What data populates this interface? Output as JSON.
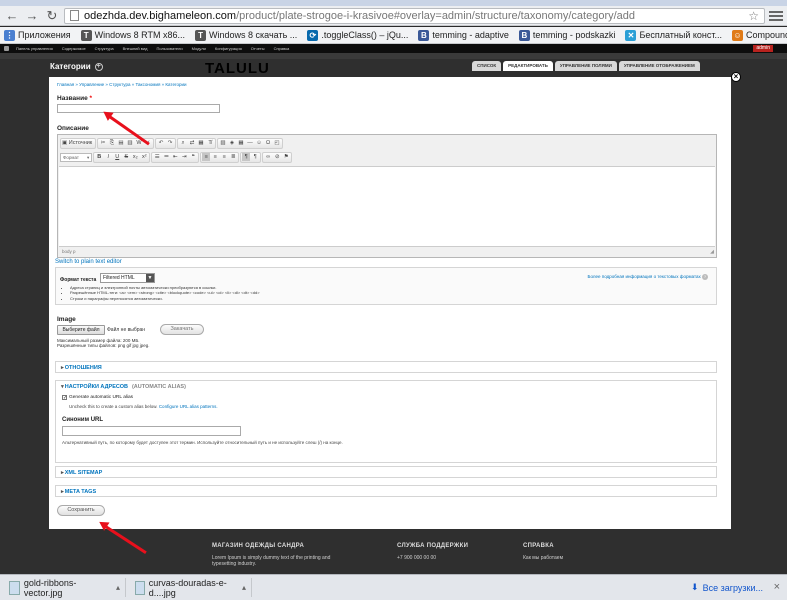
{
  "browser": {
    "url_host": "odezhda.dev.bighameleon.com",
    "url_path": "/product/plate-strogoe-i-krasivoe#overlay=admin/structure/taxonomy/category/add",
    "bookmarks": [
      {
        "label": "Приложения",
        "color": "#4a7fd0",
        "glyph": "⋮"
      },
      {
        "label": "Windows 8 RTM x86...",
        "color": "#555555",
        "glyph": "T"
      },
      {
        "label": "Windows 8 скачать ...",
        "color": "#555555",
        "glyph": "T"
      },
      {
        "label": ".toggleClass() – jQu...",
        "color": "#0769ad",
        "glyph": "⟳"
      },
      {
        "label": "temming - adaptive",
        "color": "#3b5998",
        "glyph": "B"
      },
      {
        "label": "temming - podskazki",
        "color": "#3b5998",
        "glyph": "B"
      },
      {
        "label": "Бесплатный конст...",
        "color": "#2a9fd6",
        "glyph": "✕"
      },
      {
        "label": "Compound fields in ...",
        "color": "#e07b18",
        "glyph": "☺"
      }
    ]
  },
  "admin_toolbar": {
    "items": [
      "Панель управления",
      "Содержимое",
      "Структура",
      "Внешний вид",
      "Пользователи",
      "Модули",
      "Конфигурация",
      "Отчеты",
      "Справка"
    ],
    "user_badge": "admin"
  },
  "site": {
    "logo": "TALULU",
    "footer": [
      {
        "heading": "МАГАЗИН ОДЕЖДЫ САНДРА",
        "text": "Lorem Ipsum is simply dummy text of the printing and typesetting industry."
      },
      {
        "heading": "СЛУЖБА ПОДДЕРЖКИ",
        "text": "+7 900 000 00 00"
      },
      {
        "heading": "СПРАВКА",
        "text": "Как мы работаем"
      }
    ]
  },
  "overlay": {
    "title": "Категории",
    "tabs": [
      "Список",
      "Редактировать",
      "Управление полями",
      "Управление отображением"
    ],
    "breadcrumb": "Главная » Управление » Структура » Таксономия » Категории",
    "name_label": "Название",
    "required_mark": "*",
    "description_label": "Описание",
    "editor": {
      "source_label": "Источник",
      "format_select": "Формат",
      "size_select": "Р...",
      "path": "body p"
    },
    "switch_link": "Switch to plain text editor",
    "text_format": {
      "label": "Формат текста",
      "selected": "Filtered HTML",
      "more_link": "Более подробная информация о текстовых форматах",
      "help": [
        "Адреса страниц и электронной почты автоматически преобразуются в ссылки.",
        "Разрешённые HTML-теги: <a> <em> <strong> <cite> <blockquote> <code> <ul> <ol> <li> <dl> <dt> <dd>",
        "Строки и параграфы переносятся автоматически."
      ]
    },
    "image": {
      "label": "Image",
      "choose_button": "Выберите файл",
      "no_file": "Файл не выбран",
      "upload_button": "Закачать",
      "max_size": "Максимальный размер файла: 200 МБ.",
      "allowed_types": "Разрешённые типы файлов: png gif jpg jpeg."
    },
    "fieldsets": {
      "relations": "Отношения",
      "url_settings": "Настройки адресов",
      "url_settings_sub": "(Automatic alias)",
      "generate_alias": "Generate automatic URL alias",
      "generate_checked": true,
      "uncheck_text": "Uncheck this to create a custom alias below.",
      "configure_link": "Configure URL alias patterns.",
      "alias_label": "Синоним URL",
      "alias_value": "",
      "alias_desc": "Альтернативный путь, по которому будет доступен этот термин. Используйте относительный путь и не используйте слеш (/) на конце.",
      "xml_sitemap": "XML sitemap",
      "meta_tags": "Meta tags"
    },
    "save_button": "Сохранить"
  },
  "downloads": {
    "items": [
      "gold-ribbons-vector.jpg",
      "curvas-douradas-e-d....jpg"
    ],
    "all_label": "Все загрузки..."
  }
}
